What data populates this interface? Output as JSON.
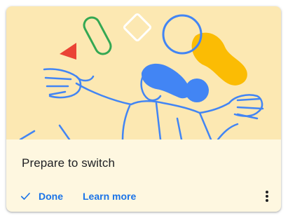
{
  "card": {
    "title": "Prepare to switch",
    "done_label": "Done",
    "learn_more_label": "Learn more",
    "illustration_icon": "juggling-person-illustration",
    "check_icon": "check-icon",
    "more_icon": "more-vert-icon"
  },
  "colors": {
    "illustration_bg": "#fce8b2",
    "card_bg": "#fef7e0",
    "accent_blue": "#1a73e8",
    "title_text": "#202124",
    "shape_red": "#ea4335",
    "shape_green": "#34a853",
    "shape_yellow": "#fbbc04",
    "figure_blue": "#4285f4"
  }
}
